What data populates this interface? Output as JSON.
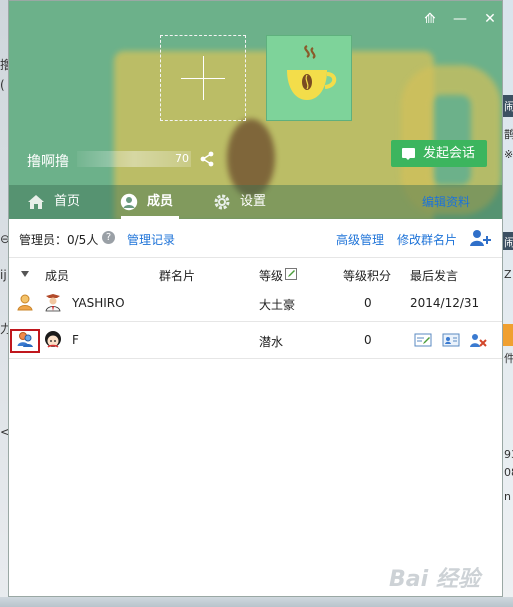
{
  "window_controls": {
    "pin": "⟰",
    "minimize": "—",
    "close": "✕"
  },
  "group": {
    "name": "撸啊撸",
    "id_suffix": "70"
  },
  "actions": {
    "start_chat": "发起会话"
  },
  "tabs": [
    {
      "label": "首页",
      "icon": "home-icon"
    },
    {
      "label": "成员",
      "icon": "member-icon",
      "active": true
    },
    {
      "label": "设置",
      "icon": "gear-icon"
    }
  ],
  "edit_profile": "编辑资料",
  "admin_bar": {
    "count_label": "管理员：0/5人",
    "help_glyph": "?",
    "log_link": "管理记录",
    "advanced_link": "高级管理",
    "edit_card_link": "修改群名片"
  },
  "table": {
    "headers": {
      "member": "成员",
      "card": "群名片",
      "level": "等级",
      "points": "等级积分",
      "last": "最后发言"
    },
    "rows": [
      {
        "name": "YASHIRO",
        "card": "",
        "level": "大土豪",
        "points": "0",
        "last": "2014/12/31"
      },
      {
        "name": "F",
        "card": "",
        "level": "潜水",
        "points": "0",
        "last": ""
      }
    ]
  },
  "background": {
    "left_texts": [
      "撸",
      "(",
      "⊖",
      "ij",
      "力",
      "<"
    ],
    "right_texts": [
      "闹",
      "鹊",
      "※",
      "闹",
      "Z",
      "件",
      "93",
      "08",
      "n"
    ]
  },
  "watermark": "Bai 经验",
  "colors": {
    "banner": "#6cb18a",
    "accent_link": "#1e73d8",
    "chat_button": "#3cb55e",
    "selection_border": "#c0171d"
  }
}
